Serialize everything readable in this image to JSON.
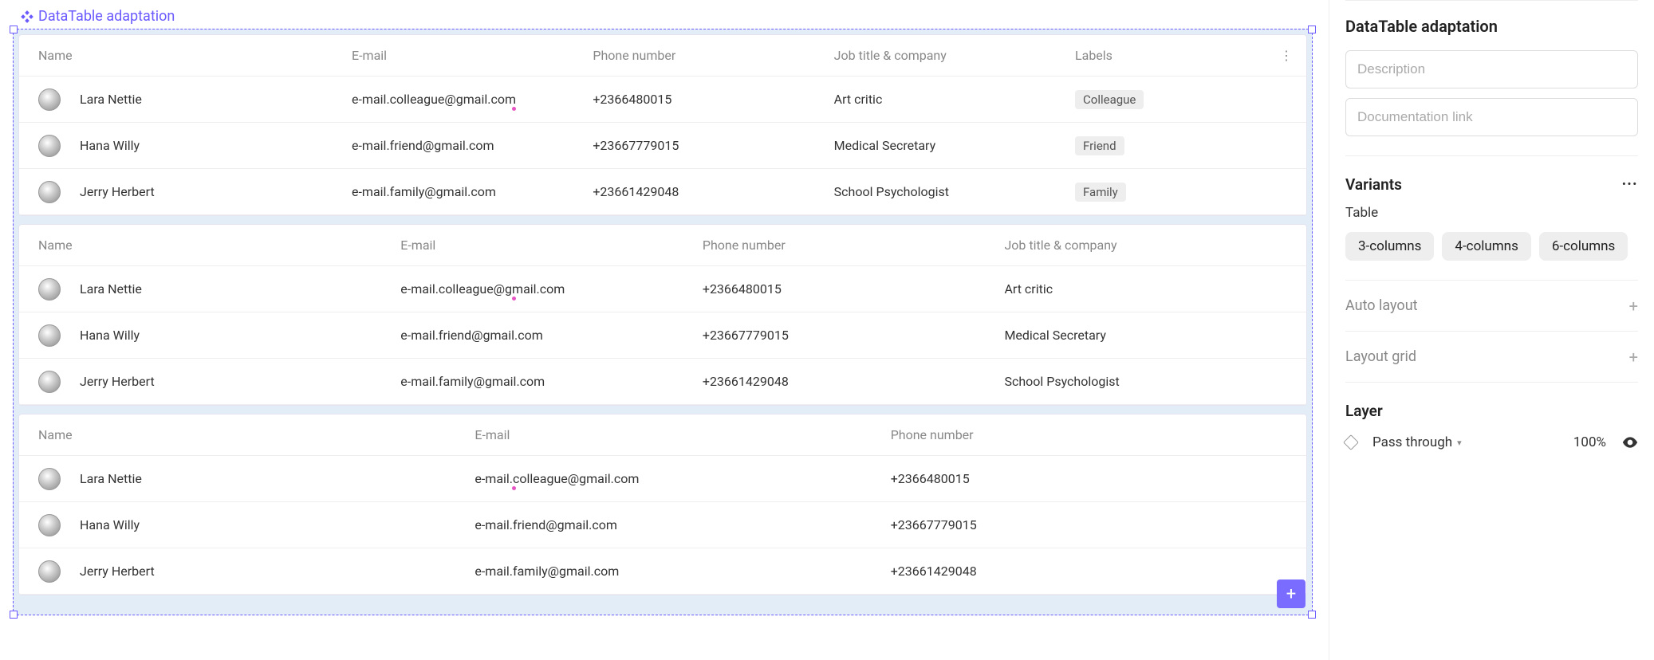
{
  "component": {
    "name": "DataTable adaptation"
  },
  "columns": {
    "name": "Name",
    "email": "E-mail",
    "phone": "Phone number",
    "job": "Job title & company",
    "labels": "Labels"
  },
  "rows": [
    {
      "name": "Lara Nettie",
      "email": "e-mail.colleague@gmail.com",
      "phone": "+2366480015",
      "job": "Art critic",
      "label": "Colleague"
    },
    {
      "name": "Hana Willy",
      "email": "e-mail.friend@gmail.com",
      "phone": "+23667779015",
      "job": "Medical Secretary",
      "label": "Friend"
    },
    {
      "name": "Jerry Herbert",
      "email": "e-mail.family@gmail.com",
      "phone": "+23661429048",
      "job": "School Psychologist",
      "label": "Family"
    }
  ],
  "panel": {
    "title": "DataTable adaptation",
    "description_placeholder": "Description",
    "doc_placeholder": "Documentation link",
    "variants_heading": "Variants",
    "variant_group": "Table",
    "variants": [
      "3-columns",
      "4-columns",
      "6-columns"
    ],
    "auto_layout": "Auto layout",
    "layout_grid": "Layout grid",
    "layer_heading": "Layer",
    "blend_mode": "Pass through",
    "opacity": "100%"
  }
}
